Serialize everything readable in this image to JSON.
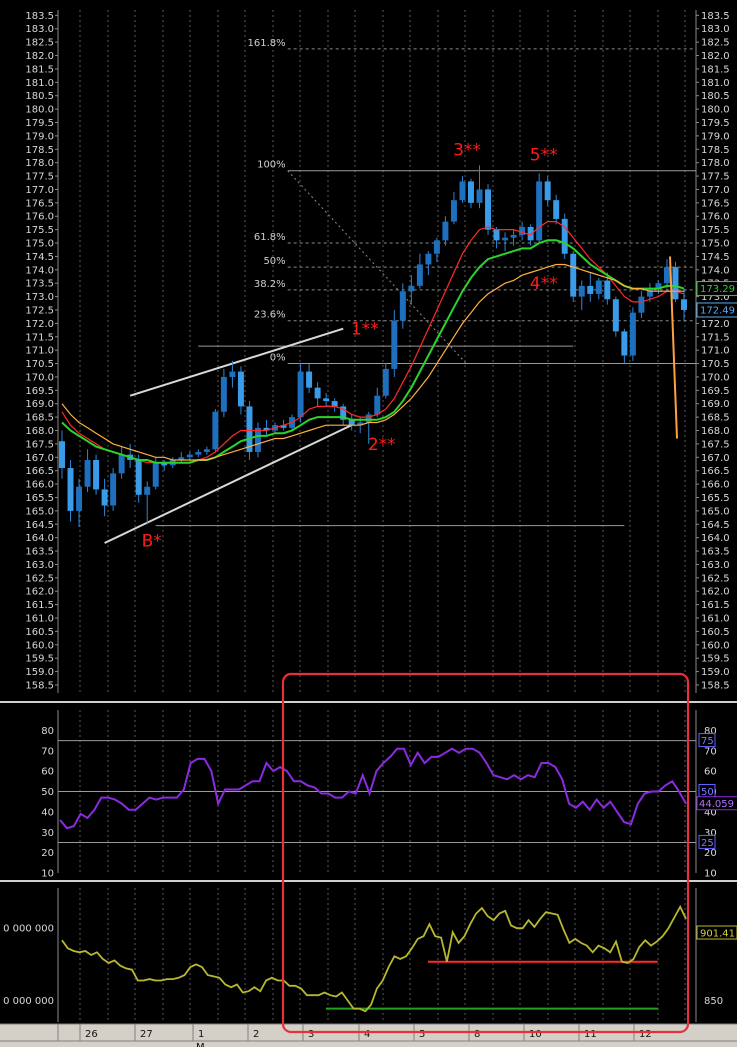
{
  "chart_data": [
    {
      "type": "candlestick",
      "panel": "price",
      "ylim": [
        158.2,
        183.7
      ],
      "y_ticks": [
        "183.5",
        "183.0",
        "182.5",
        "182.0",
        "181.5",
        "181.0",
        "180.5",
        "180.0",
        "179.5",
        "179.0",
        "178.5",
        "178.0",
        "177.5",
        "177.0",
        "176.5",
        "176.0",
        "175.5",
        "175.0",
        "174.5",
        "174.0",
        "173.5",
        "173.0",
        "172.5",
        "172.0",
        "171.5",
        "171.0",
        "170.5",
        "170.0",
        "169.5",
        "169.0",
        "168.5",
        "168.0",
        "167.5",
        "167.0",
        "166.5",
        "166.0",
        "165.5",
        "165.0",
        "164.5",
        "164.0",
        "163.5",
        "163.0",
        "162.5",
        "162.0",
        "161.5",
        "161.0",
        "160.5",
        "160.0",
        "159.5",
        "159.0",
        "158.5"
      ],
      "ohlc": [
        [
          167.6,
          168.0,
          166.2,
          166.6
        ],
        [
          166.6,
          166.9,
          164.6,
          165.0
        ],
        [
          165.0,
          166.2,
          164.4,
          165.9
        ],
        [
          165.9,
          167.3,
          165.7,
          166.9
        ],
        [
          166.9,
          167.1,
          165.6,
          165.8
        ],
        [
          165.8,
          166.2,
          164.8,
          165.2
        ],
        [
          165.2,
          166.6,
          165.0,
          166.4
        ],
        [
          166.4,
          167.4,
          166.2,
          167.1
        ],
        [
          167.1,
          167.5,
          166.6,
          166.9
        ],
        [
          166.9,
          167.1,
          165.3,
          165.6
        ],
        [
          165.6,
          166.1,
          164.5,
          165.9
        ],
        [
          165.9,
          167.0,
          165.8,
          166.8
        ],
        [
          166.8,
          166.9,
          166.5,
          166.7
        ],
        [
          166.7,
          167.0,
          166.6,
          166.9
        ],
        [
          166.9,
          167.2,
          166.8,
          167.0
        ],
        [
          167.0,
          167.2,
          166.9,
          167.1
        ],
        [
          167.1,
          167.3,
          167.0,
          167.2
        ],
        [
          167.2,
          167.4,
          167.1,
          167.3
        ],
        [
          167.3,
          168.8,
          167.2,
          168.7
        ],
        [
          168.7,
          170.3,
          168.5,
          170.0
        ],
        [
          170.0,
          170.6,
          169.6,
          170.2
        ],
        [
          170.2,
          170.4,
          168.6,
          168.9
        ],
        [
          168.9,
          169.1,
          166.9,
          167.2
        ],
        [
          167.2,
          168.3,
          167.0,
          168.1
        ],
        [
          168.1,
          168.4,
          167.8,
          168.0
        ],
        [
          168.0,
          168.3,
          167.9,
          168.2
        ],
        [
          168.2,
          168.4,
          168.0,
          168.1
        ],
        [
          168.1,
          168.6,
          168.0,
          168.5
        ],
        [
          168.5,
          170.5,
          168.3,
          170.2
        ],
        [
          170.2,
          170.5,
          169.4,
          169.6
        ],
        [
          169.6,
          169.8,
          168.9,
          169.2
        ],
        [
          169.2,
          169.4,
          168.9,
          169.1
        ],
        [
          169.1,
          169.2,
          168.7,
          168.9
        ],
        [
          168.9,
          169.0,
          168.2,
          168.4
        ],
        [
          168.4,
          168.6,
          168.0,
          168.2
        ],
        [
          168.2,
          168.5,
          167.9,
          168.3
        ],
        [
          168.3,
          168.7,
          167.5,
          168.6
        ],
        [
          168.6,
          169.6,
          168.5,
          169.3
        ],
        [
          169.3,
          170.5,
          169.2,
          170.3
        ],
        [
          170.3,
          172.5,
          170.0,
          172.1
        ],
        [
          172.1,
          173.5,
          171.8,
          173.2
        ],
        [
          173.2,
          173.8,
          172.7,
          173.4
        ],
        [
          173.4,
          174.6,
          173.3,
          174.2
        ],
        [
          174.2,
          174.7,
          173.8,
          174.6
        ],
        [
          174.6,
          175.2,
          174.3,
          175.1
        ],
        [
          175.1,
          176.0,
          174.9,
          175.8
        ],
        [
          175.8,
          176.9,
          175.7,
          176.6
        ],
        [
          176.6,
          177.5,
          176.5,
          177.3
        ],
        [
          177.3,
          177.4,
          176.3,
          176.5
        ],
        [
          176.5,
          177.9,
          176.3,
          177.0
        ],
        [
          177.0,
          177.2,
          175.3,
          175.5
        ],
        [
          175.5,
          175.6,
          174.8,
          175.1
        ],
        [
          175.1,
          175.4,
          174.7,
          175.2
        ],
        [
          175.2,
          175.5,
          174.9,
          175.3
        ],
        [
          175.3,
          175.8,
          175.1,
          175.6
        ],
        [
          175.6,
          175.7,
          174.9,
          175.1
        ],
        [
          175.1,
          177.6,
          175.0,
          177.3
        ],
        [
          177.3,
          177.5,
          176.4,
          176.6
        ],
        [
          176.6,
          176.8,
          175.7,
          175.9
        ],
        [
          175.9,
          176.1,
          174.4,
          174.6
        ],
        [
          174.6,
          174.7,
          172.8,
          173.0
        ],
        [
          173.0,
          173.6,
          172.5,
          173.4
        ],
        [
          173.4,
          173.9,
          172.8,
          173.1
        ],
        [
          173.1,
          173.7,
          172.9,
          173.6
        ],
        [
          173.6,
          173.9,
          172.7,
          172.9
        ],
        [
          172.9,
          173.0,
          171.5,
          171.7
        ],
        [
          171.7,
          171.8,
          170.5,
          170.8
        ],
        [
          170.8,
          172.6,
          170.6,
          172.4
        ],
        [
          172.4,
          173.2,
          172.2,
          173.0
        ],
        [
          173.0,
          173.5,
          172.8,
          173.3
        ],
        [
          173.3,
          173.6,
          173.1,
          173.5
        ],
        [
          173.5,
          174.4,
          173.3,
          174.1
        ],
        [
          174.1,
          174.3,
          172.8,
          172.9
        ],
        [
          172.9,
          173.3,
          172.1,
          172.5
        ]
      ],
      "ma_series": [
        {
          "color": "#ff2a2a",
          "values": [
            168.7,
            168.2,
            167.9,
            167.7,
            167.5,
            167.3,
            167.2,
            167.1,
            167.0,
            166.9,
            166.8,
            166.8,
            166.8,
            166.8,
            166.8,
            166.8,
            166.9,
            167.0,
            167.2,
            167.5,
            167.8,
            168.0,
            168.0,
            168.0,
            168.0,
            168.1,
            168.2,
            168.3,
            168.5,
            168.8,
            168.9,
            168.9,
            168.9,
            168.8,
            168.6,
            168.5,
            168.5,
            168.6,
            168.8,
            169.2,
            169.8,
            170.4,
            171.1,
            171.8,
            172.5,
            173.2,
            173.9,
            174.6,
            175.1,
            175.5,
            175.6,
            175.5,
            175.5,
            175.5,
            175.4,
            175.3,
            175.6,
            175.8,
            175.8,
            175.6,
            175.2,
            174.8,
            174.4,
            174.1,
            173.8,
            173.4,
            173.0,
            172.8,
            172.8,
            172.9,
            173.0,
            173.2,
            173.2,
            173.1
          ]
        },
        {
          "color": "#2bd42b",
          "values": [
            168.3,
            168.0,
            167.8,
            167.6,
            167.4,
            167.3,
            167.2,
            167.1,
            167.0,
            166.9,
            166.9,
            166.8,
            166.8,
            166.8,
            166.8,
            166.8,
            166.9,
            166.9,
            167.0,
            167.2,
            167.4,
            167.6,
            167.7,
            167.8,
            167.8,
            167.9,
            167.9,
            168.0,
            168.2,
            168.4,
            168.5,
            168.5,
            168.5,
            168.5,
            168.4,
            168.4,
            168.4,
            168.4,
            168.5,
            168.7,
            169.1,
            169.6,
            170.2,
            170.8,
            171.4,
            172.0,
            172.6,
            173.2,
            173.7,
            174.1,
            174.4,
            174.5,
            174.6,
            174.7,
            174.8,
            174.8,
            175.0,
            175.1,
            175.1,
            175.0,
            174.8,
            174.5,
            174.2,
            174.0,
            173.8,
            173.6,
            173.4,
            173.3,
            173.3,
            173.3,
            173.3,
            173.4,
            173.4,
            173.3
          ]
        },
        {
          "color": "#ffb040",
          "values": [
            169.0,
            168.6,
            168.3,
            168.1,
            167.9,
            167.7,
            167.5,
            167.4,
            167.3,
            167.2,
            167.1,
            167.0,
            167.0,
            166.9,
            166.9,
            166.9,
            166.9,
            166.9,
            167.0,
            167.1,
            167.2,
            167.3,
            167.4,
            167.5,
            167.6,
            167.7,
            167.7,
            167.8,
            167.9,
            168.0,
            168.1,
            168.2,
            168.2,
            168.2,
            168.2,
            168.2,
            168.3,
            168.3,
            168.4,
            168.6,
            168.9,
            169.2,
            169.6,
            170.0,
            170.5,
            171.0,
            171.5,
            172.0,
            172.4,
            172.8,
            173.1,
            173.3,
            173.5,
            173.6,
            173.8,
            173.9,
            174.0,
            174.1,
            174.2,
            174.2,
            174.1,
            174.0,
            173.9,
            173.8,
            173.7,
            173.6,
            173.4,
            173.3,
            173.3,
            173.2,
            173.2,
            173.2,
            173.2,
            173.2
          ]
        }
      ],
      "fibonacci": {
        "x_range": [
          0.36,
          1.0
        ],
        "levels": [
          {
            "label": "161.8%",
            "value": 182.25
          },
          {
            "label": "100%",
            "value": 177.7
          },
          {
            "label": "61.8%",
            "value": 175.0
          },
          {
            "label": "50%",
            "value": 174.1
          },
          {
            "label": "38.2%",
            "value": 173.25
          },
          {
            "label": "23.6%",
            "value": 172.1
          },
          {
            "label": "0%",
            "value": 170.5
          }
        ]
      },
      "wave_labels": [
        {
          "text": "B*",
          "i": 11,
          "value": 163.9
        },
        {
          "text": "1**",
          "i": 36,
          "value": 171.8
        },
        {
          "text": "2**",
          "i": 38,
          "value": 167.5
        },
        {
          "text": "3**",
          "i": 48,
          "value": 178.5
        },
        {
          "text": "4**",
          "i": 57,
          "value": 173.5
        },
        {
          "text": "5**",
          "i": 57,
          "value": 178.3
        }
      ],
      "price_boxes": [
        {
          "text": "173.29",
          "value": 173.3,
          "color": "#2bd42b"
        },
        {
          "text": "172.49",
          "value": 172.5,
          "color": "#5aaaf0"
        }
      ]
    },
    {
      "type": "line",
      "panel": "oscillator",
      "ylim": [
        10,
        90
      ],
      "y_ticks": [
        "80",
        "70",
        "60",
        "50",
        "40",
        "30",
        "20",
        "10"
      ],
      "values": [
        36,
        32,
        33,
        39,
        37,
        41,
        47,
        47,
        46,
        44,
        41,
        41,
        44,
        47,
        46,
        47,
        47,
        47,
        51,
        64,
        66,
        66,
        60,
        44,
        51,
        51,
        51,
        53,
        55,
        55,
        64,
        60,
        62,
        60,
        55,
        55,
        53,
        52,
        49,
        49,
        47,
        47,
        50,
        49,
        58,
        49,
        60,
        64,
        67,
        71,
        71,
        63,
        69,
        64,
        67,
        67,
        69,
        71,
        69,
        71,
        71,
        69,
        64,
        58,
        57,
        56,
        58,
        56,
        58,
        57,
        64,
        64,
        62,
        56,
        44,
        42,
        45,
        41,
        46,
        42,
        45,
        40,
        35,
        34,
        44,
        49,
        50,
        50,
        53,
        55,
        50,
        44
      ],
      "levels": [
        75,
        50,
        25
      ],
      "level_labels": [
        "75",
        "50",
        "25"
      ],
      "value_box": "44.059",
      "color": "#8a2be2"
    },
    {
      "type": "line",
      "panel": "volume",
      "ylim": [
        835,
        935
      ],
      "left_labels": [
        {
          "text": "0 000 000",
          "value": 905
        },
        {
          "text": "0 000 000",
          "value": 851
        }
      ],
      "right_labels": [
        {
          "text": "901.41",
          "value": 901.4,
          "boxed": true
        },
        {
          "text": "850",
          "value": 851,
          "boxed": false
        }
      ],
      "values": [
        896,
        890,
        888,
        887,
        888,
        885,
        887,
        882,
        879,
        881,
        877,
        875,
        874,
        866,
        866,
        867,
        866,
        866,
        867,
        867,
        868,
        870,
        876,
        878,
        876,
        870,
        869,
        868,
        863,
        861,
        863,
        857,
        858,
        861,
        858,
        866,
        868,
        866,
        866,
        862,
        862,
        860,
        855,
        855,
        855,
        857,
        855,
        854,
        857,
        851,
        845,
        845,
        843,
        848,
        860,
        866,
        876,
        884,
        882,
        884,
        890,
        897,
        899,
        908,
        899,
        898,
        880,
        902,
        894,
        899,
        908,
        916,
        920,
        914,
        911,
        916,
        918,
        907,
        905,
        905,
        911,
        906,
        912,
        917,
        916,
        915,
        904,
        894,
        897,
        894,
        892,
        887,
        892,
        890,
        887,
        895,
        880,
        879,
        882,
        891,
        896,
        892,
        895,
        899,
        905,
        913,
        921,
        912
      ],
      "support_lines": [
        {
          "color": "#ff2a2a",
          "x_range": [
            0.58,
            0.94
          ],
          "value": 880
        },
        {
          "color": "#22a022",
          "x_range": [
            0.42,
            0.94
          ],
          "value": 845
        }
      ],
      "color": "#b8b830"
    }
  ],
  "date_labels": [
    "26",
    "27",
    "1",
    "2",
    "3",
    "4",
    "5",
    "8",
    "10",
    "11",
    "12"
  ],
  "date_footer": "M"
}
